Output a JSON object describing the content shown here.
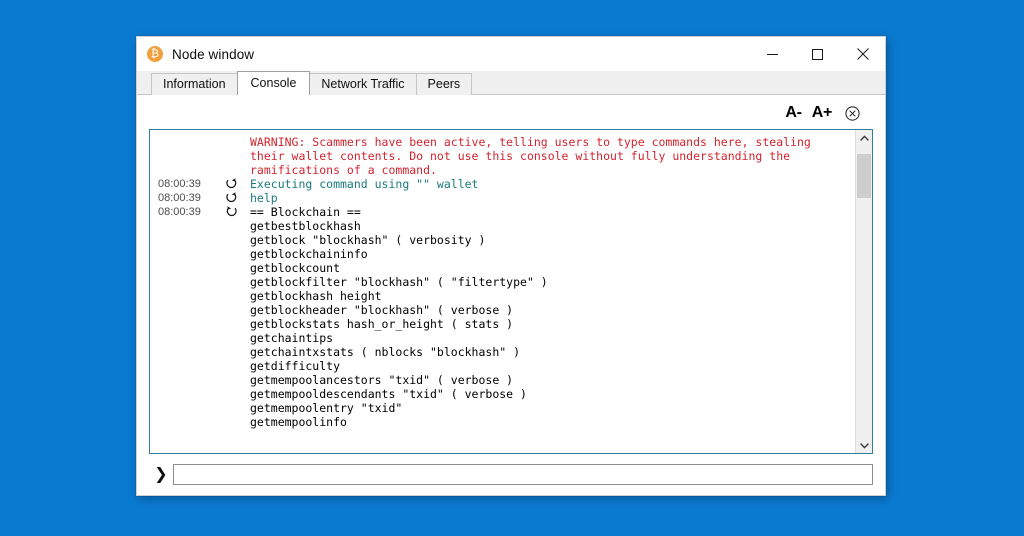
{
  "window": {
    "title": "Node window",
    "icon": "bitcoin-icon",
    "controls": {
      "minimize": "minimize-icon",
      "maximize": "maximize-icon",
      "close": "close-icon"
    }
  },
  "tabs": [
    {
      "label": "Information",
      "active": false
    },
    {
      "label": "Console",
      "active": true
    },
    {
      "label": "Network Traffic",
      "active": false
    },
    {
      "label": "Peers",
      "active": false
    }
  ],
  "toolbar": {
    "font_decrease_label": "A-",
    "font_increase_label": "A+",
    "clear_label": "clear-console-icon"
  },
  "console": {
    "lines": [
      {
        "timestamp": "",
        "direction": "",
        "style": "warn",
        "text": "WARNING: Scammers have been active, telling users to type commands here, stealing their wallet contents. Do not use this console without fully understanding the ramifications of a command."
      },
      {
        "timestamp": "08:00:39",
        "direction": "out",
        "style": "cmd",
        "text": "Executing command using \"\" wallet"
      },
      {
        "timestamp": "08:00:39",
        "direction": "out",
        "style": "cmd",
        "text": "help"
      },
      {
        "timestamp": "08:00:39",
        "direction": "in",
        "style": "out",
        "text": "== Blockchain =="
      },
      {
        "timestamp": "",
        "direction": "",
        "style": "out",
        "text": "getbestblockhash"
      },
      {
        "timestamp": "",
        "direction": "",
        "style": "out",
        "text": "getblock \"blockhash\" ( verbosity )"
      },
      {
        "timestamp": "",
        "direction": "",
        "style": "out",
        "text": "getblockchaininfo"
      },
      {
        "timestamp": "",
        "direction": "",
        "style": "out",
        "text": "getblockcount"
      },
      {
        "timestamp": "",
        "direction": "",
        "style": "out",
        "text": "getblockfilter \"blockhash\" ( \"filtertype\" )"
      },
      {
        "timestamp": "",
        "direction": "",
        "style": "out",
        "text": "getblockhash height"
      },
      {
        "timestamp": "",
        "direction": "",
        "style": "out",
        "text": "getblockheader \"blockhash\" ( verbose )"
      },
      {
        "timestamp": "",
        "direction": "",
        "style": "out",
        "text": "getblockstats hash_or_height ( stats )"
      },
      {
        "timestamp": "",
        "direction": "",
        "style": "out",
        "text": "getchaintips"
      },
      {
        "timestamp": "",
        "direction": "",
        "style": "out",
        "text": "getchaintxstats ( nblocks \"blockhash\" )"
      },
      {
        "timestamp": "",
        "direction": "",
        "style": "out",
        "text": "getdifficulty"
      },
      {
        "timestamp": "",
        "direction": "",
        "style": "out",
        "text": "getmempoolancestors \"txid\" ( verbose )"
      },
      {
        "timestamp": "",
        "direction": "",
        "style": "out",
        "text": "getmempooldescendants \"txid\" ( verbose )"
      },
      {
        "timestamp": "",
        "direction": "",
        "style": "out",
        "text": "getmempoolentry \"txid\""
      },
      {
        "timestamp": "",
        "direction": "",
        "style": "out",
        "text": "getmempoolinfo"
      }
    ],
    "scrollbar": {
      "up": "scroll-up-icon",
      "down": "scroll-down-icon"
    }
  },
  "input": {
    "prompt": "❯",
    "value": "",
    "placeholder": ""
  },
  "colors": {
    "desktop": "#0a7ad1",
    "warning": "#d1242f",
    "command": "#1a7b80",
    "console_border": "#2d7ea0",
    "accent_icon": "#f2a03d"
  }
}
